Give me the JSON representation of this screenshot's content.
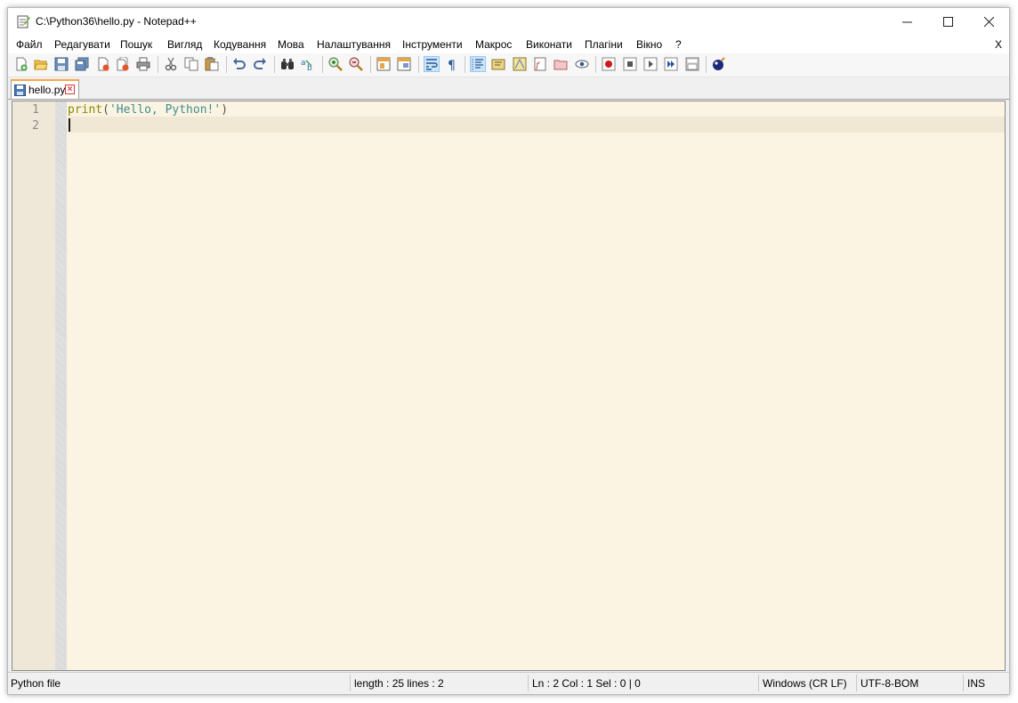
{
  "window": {
    "title": "C:\\Python36\\hello.py - Notepad++"
  },
  "menu": {
    "items": [
      "Файл",
      "Редагувати",
      "Пошук",
      "Вигляд",
      "Кодування",
      "Мова",
      "Налаштування",
      "Інструменти",
      "Макрос",
      "Виконати",
      "Плагіни",
      "Вікно",
      "?"
    ],
    "close_label": "X"
  },
  "tab": {
    "label": "hello.py"
  },
  "editor": {
    "line_numbers": [
      "1",
      "2"
    ],
    "lines": [
      {
        "keyword": "print",
        "open": "(",
        "string": "'Hello, Python!'",
        "close": ")"
      },
      {
        "text": ""
      }
    ]
  },
  "status": {
    "filetype": "Python file",
    "length_lines": "length : 25    lines : 2",
    "position": "Ln : 2    Col : 1    Sel : 0 | 0",
    "eol": "Windows (CR LF)",
    "encoding": "UTF-8-BOM",
    "mode": "INS"
  },
  "colors": {
    "editor_bg": "#fcf4e3",
    "keyword": "#8a8a00",
    "string": "#3e8e8e",
    "tab_accent": "#f6a64a"
  },
  "icons": [
    "new-file-icon",
    "open-file-icon",
    "save-icon",
    "save-all-icon",
    "close-icon",
    "close-all-icon",
    "print-icon",
    "cut-icon",
    "copy-icon",
    "paste-icon",
    "undo-icon",
    "redo-icon",
    "find-icon",
    "replace-icon",
    "zoom-in-icon",
    "zoom-out-icon",
    "sync-vertical-icon",
    "sync-horizontal-icon",
    "word-wrap-icon",
    "show-all-chars-icon",
    "indent-guide-icon",
    "user-lang-icon",
    "doc-map-icon",
    "function-list-icon",
    "folder-workspace-icon",
    "monitoring-icon",
    "record-macro-icon",
    "stop-macro-icon",
    "play-macro-icon",
    "run-macro-multiple-icon",
    "save-macro-icon",
    "run-icon"
  ]
}
